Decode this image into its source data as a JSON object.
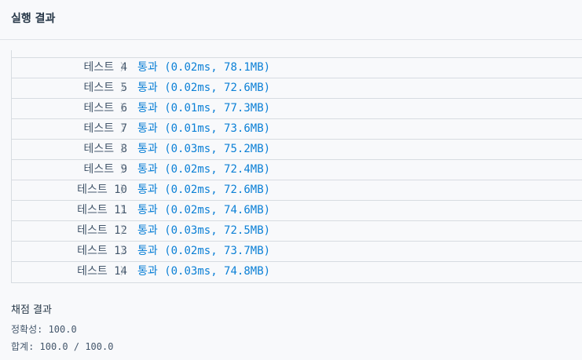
{
  "header": {
    "title": "실행 결과"
  },
  "tests": [
    {
      "label": "테스트 4",
      "result": "통과 (0.02ms, 78.1MB)"
    },
    {
      "label": "테스트 5",
      "result": "통과 (0.02ms, 72.6MB)"
    },
    {
      "label": "테스트 6",
      "result": "통과 (0.01ms, 77.3MB)"
    },
    {
      "label": "테스트 7",
      "result": "통과 (0.01ms, 73.6MB)"
    },
    {
      "label": "테스트 8",
      "result": "통과 (0.03ms, 75.2MB)"
    },
    {
      "label": "테스트 9",
      "result": "통과 (0.02ms, 72.4MB)"
    },
    {
      "label": "테스트 10",
      "result": "통과 (0.02ms, 72.6MB)"
    },
    {
      "label": "테스트 11",
      "result": "통과 (0.02ms, 74.6MB)"
    },
    {
      "label": "테스트 12",
      "result": "통과 (0.03ms, 72.5MB)"
    },
    {
      "label": "테스트 13",
      "result": "통과 (0.02ms, 73.7MB)"
    },
    {
      "label": "테스트 14",
      "result": "통과 (0.03ms, 74.8MB)"
    }
  ],
  "grading": {
    "title": "채점 결과",
    "accuracy": "정확성: 100.0",
    "total": "합계: 100.0 / 100.0"
  },
  "colors": {
    "pass": "#0c80d6",
    "label": "#44576c",
    "divider": "#d7dce1"
  },
  "icons": {
    "row_chevron": "chevron-right-icon"
  }
}
